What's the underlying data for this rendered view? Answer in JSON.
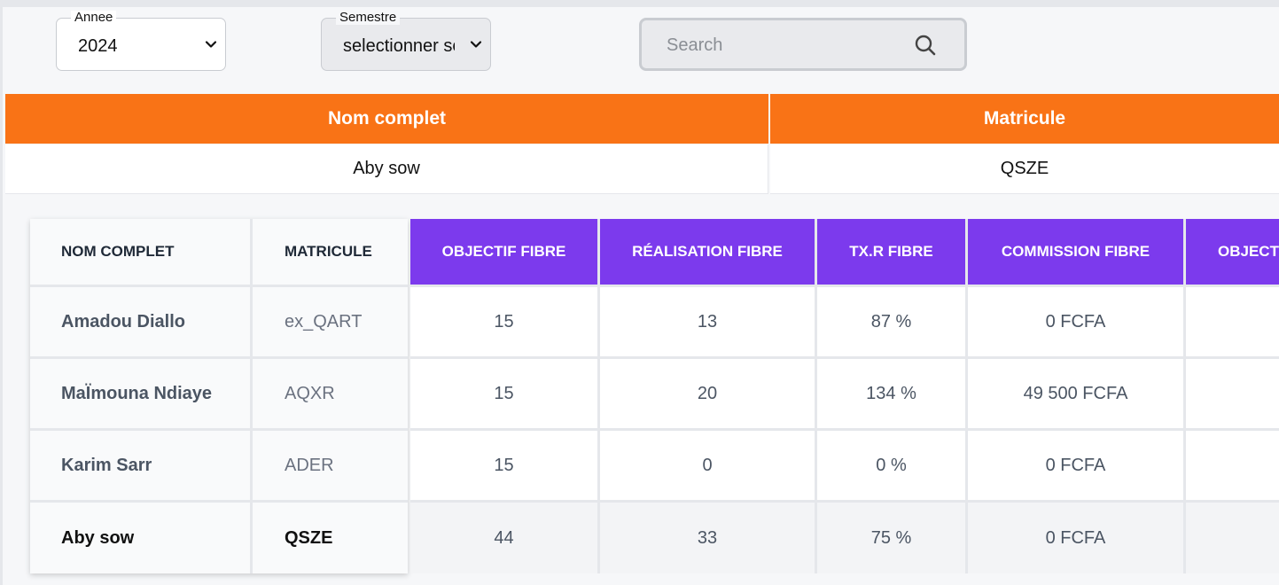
{
  "filters": {
    "year": {
      "label": "Annee",
      "value": "2024"
    },
    "semester": {
      "label": "Semestre",
      "value": "selectionner semestre"
    },
    "search": {
      "placeholder": "Search",
      "icon": "search-icon"
    }
  },
  "summary": {
    "headers": {
      "name": "Nom complet",
      "matricule": "Matricule"
    },
    "row": {
      "name": "Aby sow",
      "matricule": "QSZE"
    }
  },
  "table": {
    "headers": {
      "name": "NOM COMPLET",
      "matricule": "MATRICULE",
      "objectif_fibre": "OBJECTIF FIBRE",
      "realisation_fibre": "RÉALISATION FIBRE",
      "txr_fibre": "TX.R FIBRE",
      "commission_fibre": "COMMISSION FIBRE",
      "next_partial": "OBJECT"
    },
    "rows": [
      {
        "name": "Amadou Diallo",
        "matricule": "ex_QART",
        "objectif": "15",
        "realisation": "13",
        "txr": "87 %",
        "commission": "0 FCFA"
      },
      {
        "name": "MaÏmouna Ndiaye",
        "matricule": "AQXR",
        "objectif": "15",
        "realisation": "20",
        "txr": "134 %",
        "commission": "49 500 FCFA"
      },
      {
        "name": "Karim Sarr",
        "matricule": "ADER",
        "objectif": "15",
        "realisation": "0",
        "txr": "0 %",
        "commission": "0 FCFA"
      }
    ],
    "total": {
      "name": "Aby sow",
      "matricule": "QSZE",
      "objectif": "44",
      "realisation": "33",
      "txr": "75 %",
      "commission": "0 FCFA"
    }
  },
  "colors": {
    "orange": "#f97316",
    "purple": "#7c3aed"
  }
}
